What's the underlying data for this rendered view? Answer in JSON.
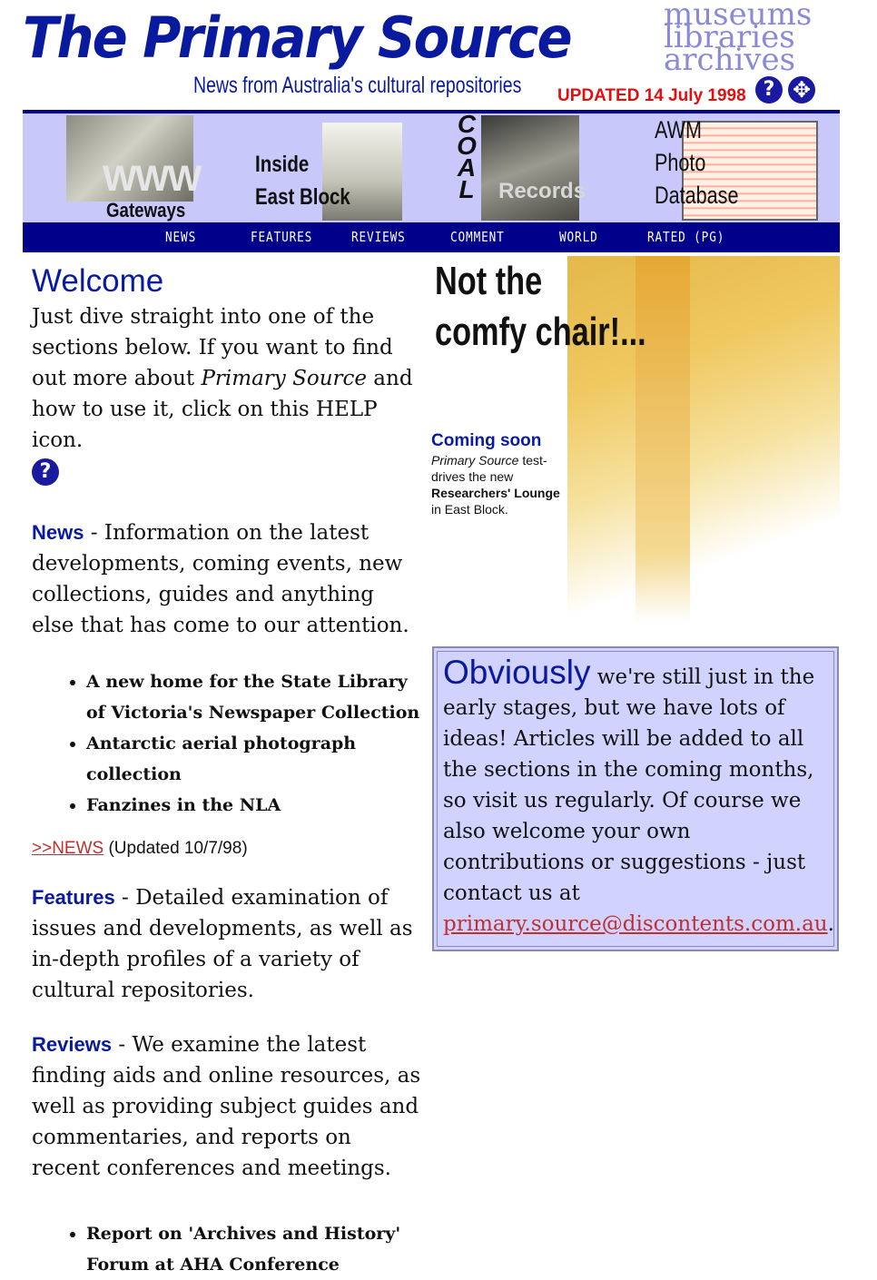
{
  "header": {
    "title": "The Primary Source",
    "subtitle": "News from Australia's cultural repositories",
    "side_logo": [
      "museums",
      "libraries",
      "archives"
    ],
    "updated": "UPDATED 14 July 1998",
    "help_icon": "?",
    "arrows_icon": "✥"
  },
  "banner": {
    "gateways": {
      "label": "Gateways",
      "photo_text": "WWW"
    },
    "east_block": {
      "label_line1": "Inside",
      "label_line2": "East Block"
    },
    "coal": {
      "vertical": [
        "C",
        "O",
        "A",
        "L"
      ],
      "photo_text": "Records"
    },
    "awm": {
      "line1": "AWM",
      "line2": "Photo",
      "line3": "Database"
    }
  },
  "nav": [
    {
      "label": "NEWS"
    },
    {
      "label": "FEATURES"
    },
    {
      "label": "REVIEWS"
    },
    {
      "label": "COMMENT"
    },
    {
      "label": "WORLD"
    },
    {
      "label": "RATED (PG)"
    }
  ],
  "welcome": {
    "heading": "Welcome",
    "text_a": "Just dive straight into one of the sections below. If you want to find out more about ",
    "text_em": "Primary Source",
    "text_b": " and how to use it, click on this HELP icon.",
    "help_icon": "?"
  },
  "news": {
    "name": "News",
    "desc": " - Information on the latest developments, coming events, new collections, guides and anything else that has come to our attention.",
    "items": [
      "A new home for the State Library of Victoria's Newspaper Collection",
      "Antarctic aerial photograph collection",
      "Fanzines in the NLA"
    ],
    "link": ">>NEWS",
    "link_note": " (Updated 10/7/98)"
  },
  "features": {
    "name": "Features",
    "desc": " - Detailed examination of issues and developments, as well as in-depth profiles of a variety of cultural repositories."
  },
  "reviews": {
    "name": "Reviews",
    "desc": " - We examine the latest finding aids and online resources, as well as providing subject guides and commentaries, and reports on recent conferences and meetings.",
    "items": [
      "Report on 'Archives and History' Forum at AHA Conference"
    ]
  },
  "promo": {
    "headline_1": "Not the",
    "headline_2": "comfy chair!...",
    "coming": "Coming soon",
    "em": "Primary Source",
    "text_1": " test-drives the new ",
    "bold": "Researchers' Lounge",
    "text_2": " in East Block."
  },
  "obviously": {
    "lead": "Obviously",
    "text": " we're still just in the early stages, but we have lots of ideas! Articles will be added to all the sections in the coming months, so visit us regularly. Of course we also welcome your own contributions or suggestions - just contact us at ",
    "email": "primary.source@discontents.com.au",
    "end": "."
  }
}
